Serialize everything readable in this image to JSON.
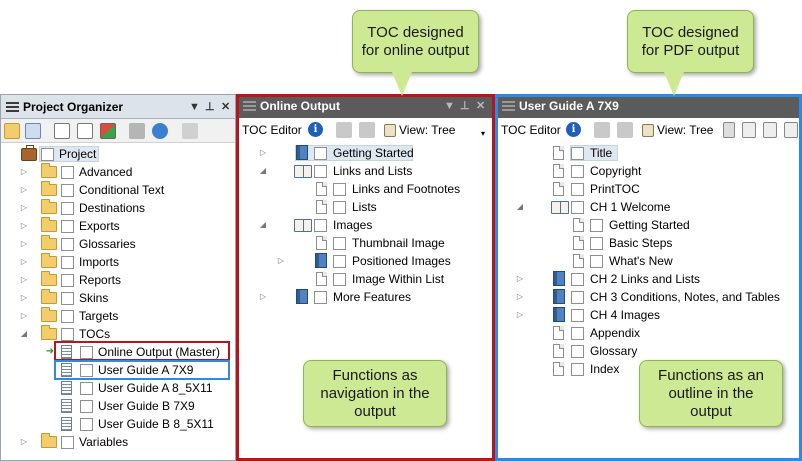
{
  "callouts": {
    "toc_online": "TOC designed for online output",
    "toc_pdf": "TOC designed for PDF output",
    "func_nav": "Functions as navigation in the output",
    "func_outline": "Functions as an outline in the output"
  },
  "project_organizer": {
    "title": "Project Organizer",
    "items": [
      {
        "label": "Project",
        "icon": "briefcase-icon"
      },
      {
        "label": "Advanced",
        "icon": "folder-icon"
      },
      {
        "label": "Conditional Text",
        "icon": "folder-icon"
      },
      {
        "label": "Destinations",
        "icon": "folder-icon"
      },
      {
        "label": "Exports",
        "icon": "folder-icon"
      },
      {
        "label": "Glossaries",
        "icon": "folder-icon"
      },
      {
        "label": "Imports",
        "icon": "folder-icon"
      },
      {
        "label": "Reports",
        "icon": "folder-icon"
      },
      {
        "label": "Skins",
        "icon": "folder-icon"
      },
      {
        "label": "Targets",
        "icon": "folder-icon"
      },
      {
        "label": "TOCs",
        "icon": "folder-open-icon"
      },
      {
        "label": "Online Output (Master)",
        "icon": "toc-file-icon"
      },
      {
        "label": "User Guide A 7X9",
        "icon": "toc-file-icon"
      },
      {
        "label": "User Guide A 8_5X11",
        "icon": "toc-file-icon"
      },
      {
        "label": "User Guide B 7X9",
        "icon": "toc-file-icon"
      },
      {
        "label": "User Guide B 8_5X11",
        "icon": "toc-file-icon"
      },
      {
        "label": "Variables",
        "icon": "folder-icon"
      }
    ]
  },
  "online_output": {
    "title": "Online Output",
    "toolbar": {
      "toc_editor": "TOC Editor",
      "view": "View: Tree"
    },
    "items": [
      {
        "label": "Getting Started",
        "icon": "book-closed-icon"
      },
      {
        "label": "Links and Lists",
        "icon": "book-open-icon"
      },
      {
        "label": "Links and Footnotes",
        "icon": "page-icon"
      },
      {
        "label": "Lists",
        "icon": "page-icon"
      },
      {
        "label": "Images",
        "icon": "book-open-icon"
      },
      {
        "label": "Thumbnail Image",
        "icon": "page-icon"
      },
      {
        "label": "Positioned Images",
        "icon": "book-closed-icon"
      },
      {
        "label": "Image Within List",
        "icon": "page-icon"
      },
      {
        "label": "More Features",
        "icon": "book-closed-icon"
      }
    ]
  },
  "user_guide": {
    "title": "User Guide A 7X9",
    "toolbar": {
      "toc_editor": "TOC Editor",
      "view": "View: Tree"
    },
    "items": [
      {
        "label": "Title",
        "icon": "page-icon"
      },
      {
        "label": "Copyright",
        "icon": "page-icon"
      },
      {
        "label": "PrintTOC",
        "icon": "page-icon"
      },
      {
        "label": "CH 1 Welcome",
        "icon": "book-open-icon"
      },
      {
        "label": "Getting Started",
        "icon": "page-icon"
      },
      {
        "label": "Basic Steps",
        "icon": "page-icon"
      },
      {
        "label": "What's New",
        "icon": "page-icon"
      },
      {
        "label": "CH 2 Links and Lists",
        "icon": "book-closed-icon"
      },
      {
        "label": "CH 3 Conditions, Notes, and Tables",
        "icon": "book-closed-icon"
      },
      {
        "label": "CH 4 Images",
        "icon": "book-closed-icon"
      },
      {
        "label": "Appendix",
        "icon": "page-icon"
      },
      {
        "label": "Glossary",
        "icon": "page-icon"
      },
      {
        "label": "Index",
        "icon": "page-icon"
      }
    ]
  },
  "colors": {
    "red_frame": "#b8141a",
    "blue_frame": "#2b8be6",
    "callout": "#cde994"
  }
}
